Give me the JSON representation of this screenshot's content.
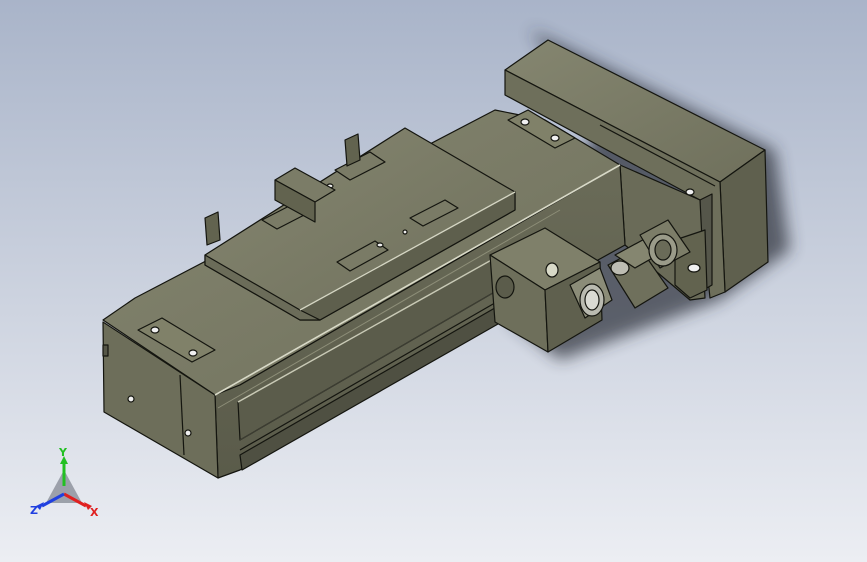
{
  "viewport": {
    "background_top": "#a9b4c9",
    "background_bottom": "#eceef3",
    "model_color": "#747562",
    "edge_color": "#14150f"
  },
  "triad": {
    "x_label": "X",
    "y_label": "Y",
    "z_label": "Z",
    "x_color": "#e02020",
    "y_color": "#22c022",
    "z_color": "#2040e0"
  }
}
